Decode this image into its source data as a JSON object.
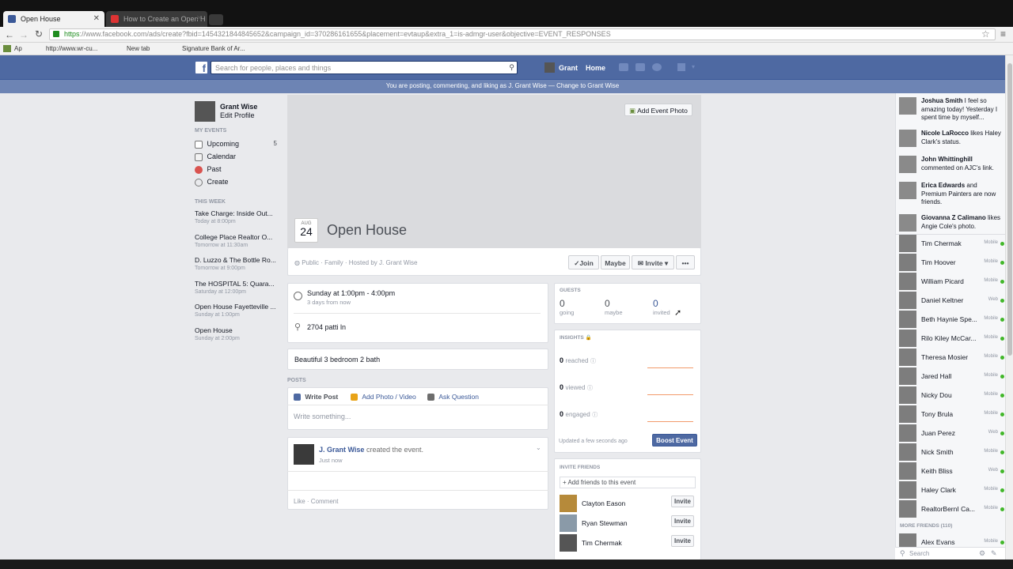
{
  "browser": {
    "tabs": [
      {
        "title": "Open House"
      },
      {
        "title": "How to Create an Open H"
      }
    ],
    "url_secure": "https",
    "url_rest": "://www.facebook.com/ads/create?fbid=1454321844845652&campaign_id=370286161655&placement=evtaup&extra_1=is-admgr-user&objective=EVENT_RESPONSES",
    "bookmarks": [
      "Ap",
      "http://www.wr-cu...",
      "New tab",
      "Signature Bank of Ar..."
    ]
  },
  "header": {
    "search_placeholder": "Search for people, places and things",
    "profile_name": "Grant",
    "home_label": "Home",
    "posting_notice": "You are posting, commenting, and liking as J. Grant Wise — Change to Grant Wise"
  },
  "left_nav": {
    "profile_name": "Grant Wise",
    "edit_profile": "Edit Profile",
    "my_events_heading": "MY EVENTS",
    "items": [
      {
        "label": "Upcoming",
        "count": "5"
      },
      {
        "label": "Calendar",
        "count": ""
      },
      {
        "label": "Past",
        "count": ""
      },
      {
        "label": "Create",
        "count": ""
      }
    ],
    "this_week_heading": "THIS WEEK",
    "week_events": [
      {
        "title": "Take Charge: Inside Out...",
        "time": "Today at 8:00pm"
      },
      {
        "title": "College Place Realtor O...",
        "time": "Tomorrow at 11:30am"
      },
      {
        "title": "D. Luzzo & The Bottle Ro...",
        "time": "Tomorrow at 9:00pm"
      },
      {
        "title": "The HOSPITAL 5: Quara...",
        "time": "Saturday at 12:00pm"
      },
      {
        "title": "Open House Fayetteville ...",
        "time": "Sunday at 1:00pm"
      },
      {
        "title": "Open House",
        "time": "Sunday at 2:00pm"
      }
    ]
  },
  "event": {
    "add_photo": "Add Event Photo",
    "month": "AUG",
    "day": "24",
    "title": "Open House",
    "meta": "Public · Family · Hosted by J. Grant Wise",
    "join": "Join",
    "maybe": "Maybe",
    "invite": "Invite",
    "more": "•••",
    "time_main": "Sunday at 1:00pm - 4:00pm",
    "time_sub": "3 days from now",
    "location": "2704 patti ln",
    "description": "Beautiful 3 bedroom 2 bath"
  },
  "posts": {
    "heading": "POSTS",
    "write_post": "Write Post",
    "add_photo": "Add Photo / Video",
    "ask_question": "Ask Question",
    "composer_placeholder": "Write something...",
    "author": "J. Grant Wise",
    "action": "created the event.",
    "time": "Just now",
    "like_comment": "Like · Comment"
  },
  "guests": {
    "heading": "GUESTS",
    "going_count": "0",
    "going_label": "going",
    "maybe_count": "0",
    "maybe_label": "maybe",
    "invited_count": "0",
    "invited_label": "invited"
  },
  "insights": {
    "heading": "INSIGHTS",
    "reached_count": "0",
    "reached_label": "reached",
    "viewed_count": "0",
    "viewed_label": "viewed",
    "engaged_count": "0",
    "engaged_label": "engaged",
    "updated": "Updated a few seconds ago",
    "boost": "Boost Event"
  },
  "invite_friends": {
    "heading": "INVITE FRIENDS",
    "add_placeholder": "+ Add friends to this event",
    "invite_label": "Invite",
    "friends": [
      "Clayton Eason",
      "Ryan Stewman",
      "Tim Chermak"
    ]
  },
  "ticker": [
    {
      "name": "Joshua Smith",
      "text": " I feel so amazing today! Yesterday I spent time by myself..."
    },
    {
      "name": "Nicole LaRocco",
      "text": " likes Haley Clark's status."
    },
    {
      "name": "John Whittinghill",
      "text": " commented on AJC's link."
    },
    {
      "name": "Erica Edwards",
      "text": " and Premium Painters are now friends."
    },
    {
      "name": "Giovanna Z Calimano",
      "text": " likes Angie Cole's photo."
    }
  ],
  "chat": {
    "online": [
      {
        "name": "Tim Chermak",
        "status": "Mobile"
      },
      {
        "name": "Tim Hoover",
        "status": "Mobile"
      },
      {
        "name": "William Picard",
        "status": "Mobile"
      },
      {
        "name": "Daniel Keltner",
        "status": "Web"
      },
      {
        "name": "Beth Haynie Spe...",
        "status": "Mobile"
      },
      {
        "name": "Rilo Kiley McCar...",
        "status": "Mobile"
      },
      {
        "name": "Theresa Mosier",
        "status": "Mobile"
      },
      {
        "name": "Jared Hall",
        "status": "Mobile"
      },
      {
        "name": "Nicky Dou",
        "status": "Mobile"
      },
      {
        "name": "Tony Brula",
        "status": "Mobile"
      },
      {
        "name": "Juan Perez",
        "status": "Web"
      },
      {
        "name": "Nick Smith",
        "status": "Mobile"
      },
      {
        "name": "Keith Bliss",
        "status": "Web"
      },
      {
        "name": "Haley Clark",
        "status": "Mobile"
      },
      {
        "name": "RealtorBernI Ca...",
        "status": "Mobile"
      }
    ],
    "more_friends": "MORE FRIENDS (110)",
    "more_list": [
      {
        "name": "Alex Evans",
        "status": "Mobile"
      }
    ],
    "search_placeholder": "Search"
  },
  "colors": {
    "fb_blue": "#4e69a2",
    "fb_blue_dark": "#3b5998",
    "online_green": "#42b72a",
    "sparkline_orange": "#f29b6b"
  }
}
